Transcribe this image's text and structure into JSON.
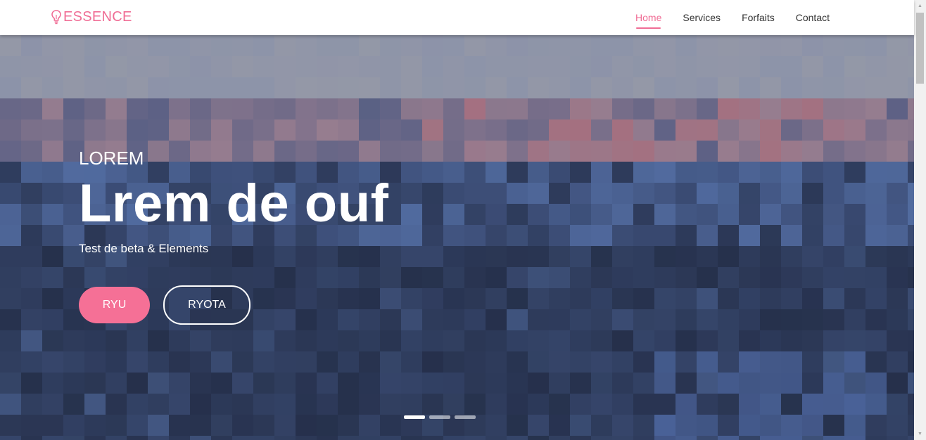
{
  "brand": {
    "name": "ESSENCE",
    "icon": "lightbulb-icon",
    "color": "#f06d95"
  },
  "nav": {
    "items": [
      {
        "label": "Home",
        "active": true
      },
      {
        "label": "Services",
        "active": false
      },
      {
        "label": "Forfaits",
        "active": false
      },
      {
        "label": "Contact",
        "active": false
      }
    ]
  },
  "hero": {
    "eyebrow": "LOREM",
    "headline": "Lrem de ouf",
    "subline": "Test de beta & Elements",
    "primary_button": "RYU",
    "secondary_button": "RYOTA",
    "slide_count": 3,
    "active_slide": 0
  },
  "colors": {
    "accent": "#f57096",
    "text_dark": "#333333",
    "hero_overlay": "#34415c"
  }
}
